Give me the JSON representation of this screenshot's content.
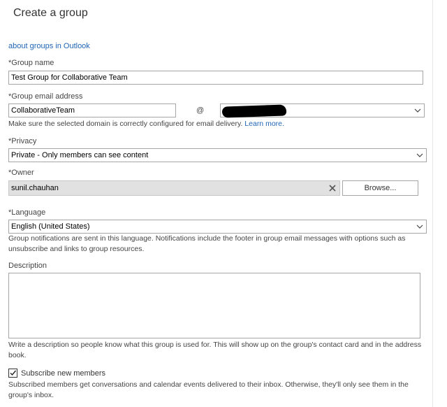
{
  "title": "Create a group",
  "about_link": "about groups in Outlook",
  "group_name": {
    "label": "*Group name",
    "value": "Test Group for Collaborative Team"
  },
  "group_email": {
    "label": "*Group email address",
    "value": "CollaborativeTeam",
    "at": "@",
    "domain_value": "",
    "help": "Make sure the selected domain is correctly configured for email delivery.",
    "learn_more": "Learn more."
  },
  "privacy": {
    "label": "*Privacy",
    "value": "Private - Only members can see content"
  },
  "owner": {
    "label": "*Owner",
    "value": "sunil.chauhan",
    "browse_label": "Browse..."
  },
  "language": {
    "label": "*Language",
    "value": "English (United States)",
    "help": "Group notifications are sent in this language. Notifications include the footer in group email messages with options such as unsubscribe and links to group resources."
  },
  "description": {
    "label": "Description",
    "value": "",
    "help": "Write a description so people know what this group is used for. This will show up on the group's contact card and in the address book."
  },
  "subscribe": {
    "label": "Subscribe new members",
    "checked": true,
    "help": "Subscribed members get conversations and calendar events delivered to their inbox. Otherwise, they'll only see them in the group's inbox."
  }
}
